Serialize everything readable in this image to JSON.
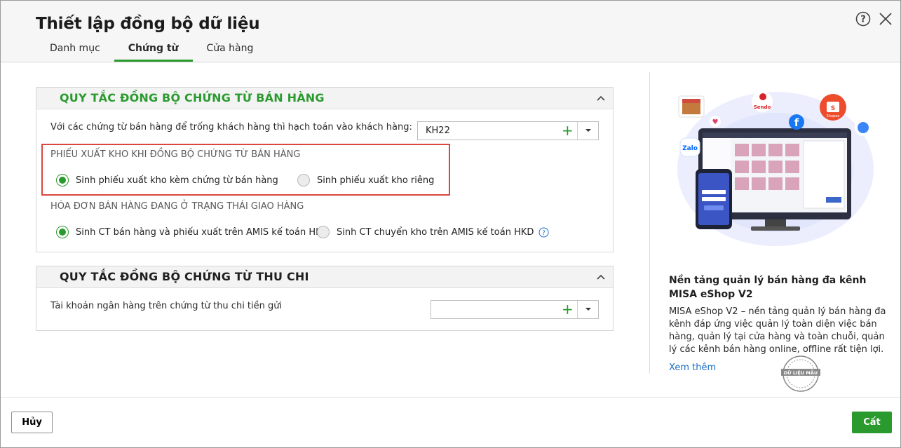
{
  "dialog": {
    "title": "Thiết lập đồng bộ dữ liệu",
    "tabs": [
      {
        "label": "Danh mục"
      },
      {
        "label": "Chứng từ"
      },
      {
        "label": "Cửa hàng"
      }
    ],
    "active_tab": "Chứng từ"
  },
  "sales_section": {
    "title": "QUY TẮC ĐỒNG BỘ CHỨNG TỪ BÁN HÀNG",
    "customer_label": "Với các chứng từ bán hàng để trống khách hàng thì hạch toán vào khách hàng:",
    "customer_value": "KH22",
    "stock_out_heading": "PHIẾU XUẤT KHO KHI ĐỒNG BỘ CHỨNG TỪ BÁN HÀNG",
    "stock_out_options": [
      {
        "label": "Sinh phiếu xuất kho kèm chứng từ bán hàng",
        "selected": true
      },
      {
        "label": "Sinh phiếu xuất kho riêng",
        "selected": false
      }
    ],
    "delivery_heading": "HÓA ĐƠN BÁN HÀNG ĐANG Ở TRẠNG THÁI GIAO HÀNG",
    "delivery_options": [
      {
        "label": "Sinh CT bán hàng và phiếu xuất trên AMIS kế toán HKD",
        "selected": true
      },
      {
        "label": "Sinh CT chuyển kho trên AMIS kế toán HKD",
        "selected": false
      }
    ]
  },
  "cash_section": {
    "title": "QUY TẮC ĐỒNG BỘ CHỨNG TỪ THU CHI",
    "bank_label": "Tài khoản ngân hàng trên chứng từ thu chi tiền gửi",
    "bank_value": ""
  },
  "promo": {
    "title": "Nền tảng quản lý bán hàng đa kênh MISA eShop V2",
    "description": "MISA eShop V2 – nền tảng quản lý bán hàng đa kênh đáp ứng việc quản lý toàn diện việc bán hàng, quản lý tại cửa hàng và toàn chuỗi, quản lý các kênh bán hàng online, offline rất tiện lợi.",
    "link": "Xem thêm",
    "stamp_text": "DỮ LIỆU MẪU",
    "channel_labels": {
      "sendo": "Sendo",
      "shopee": "Shopee",
      "zalo": "Zalo"
    }
  },
  "footer": {
    "cancel_label": "Hủy",
    "save_label": "Cất"
  },
  "colors": {
    "accent": "#2a9a2f",
    "highlight_box": "#d9473f",
    "link": "#1a6fc4"
  }
}
